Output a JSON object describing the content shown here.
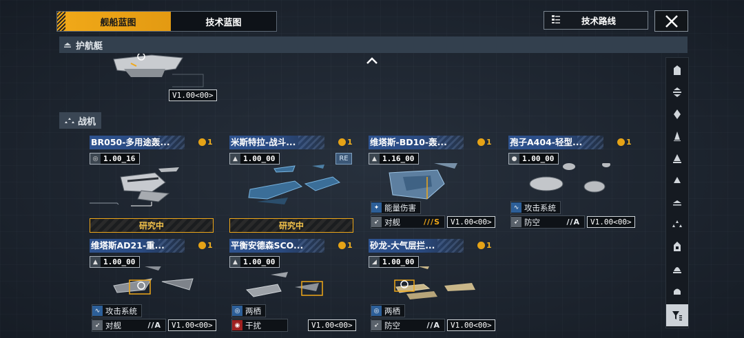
{
  "tabs": [
    {
      "label": "舰船蓝图",
      "active": true
    },
    {
      "label": "技术蓝图",
      "active": false
    }
  ],
  "tech_route_label": "技术路线",
  "section_escort": "护航艇",
  "prev_ship": {
    "version": "V1.00<00>"
  },
  "section_fighter": "战机",
  "cards": [
    {
      "title": "BR050-多用途轰...",
      "count": "1",
      "score": "1.00_16",
      "research": "研究中"
    },
    {
      "title": "米斯特拉-战斗...",
      "count": "1",
      "score": "1.00_00",
      "re": "RE",
      "research": "研究中"
    },
    {
      "title": "维塔斯-BD10-轰...",
      "count": "1",
      "score": "1.16_00",
      "attr1": "能量伤害",
      "attr2": "对舰",
      "role": "///S",
      "version": "V1.00<00>"
    },
    {
      "title": "孢子A404-轻型...",
      "count": "1",
      "score": "1.00_00",
      "attr1": "攻击系统",
      "attr2": "防空",
      "role": "//A",
      "version": "V1.00<00>"
    },
    {
      "title": "维塔斯AD21-重...",
      "count": "1",
      "score": "1.00_00",
      "attr1": "攻击系统",
      "attr2": "对舰",
      "role": "//A",
      "version": "V1.00<00>"
    },
    {
      "title": "平衡安德森SCO...",
      "count": "1",
      "score": "1.00_00",
      "attr1": "两栖",
      "attr2": "干扰",
      "version": "V1.00<00>"
    },
    {
      "title": "砂龙-大气层拦...",
      "count": "1",
      "score": "1.00_00",
      "attr1": "两栖",
      "attr2": "防空",
      "role": "//A",
      "version": "V1.00<00>"
    }
  ],
  "colors": {
    "accent": "#f0a818",
    "title_bar": "#2e5390",
    "bg": "#202833"
  }
}
